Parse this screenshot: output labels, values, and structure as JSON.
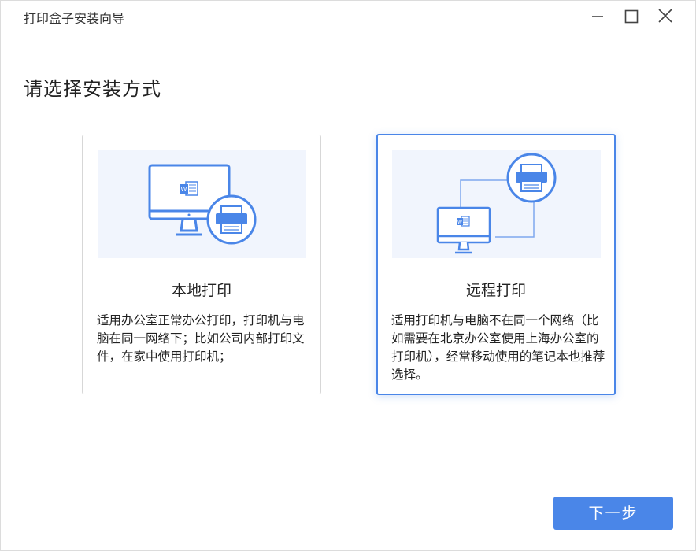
{
  "window": {
    "title": "打印盒子安装向导"
  },
  "heading": "请选择安装方式",
  "options": [
    {
      "title": "本地打印",
      "description": "适用办公室正常办公打印，打印机与电脑在同一网络下；比如公司内部打印文件，在家中使用打印机；",
      "selected": false
    },
    {
      "title": "远程打印",
      "description": "适用打印机与电脑不在同一个网络（比如需要在北京办公室使用上海办公室的打印机），经常移动使用的笔记本也推荐选择。",
      "selected": true
    }
  ],
  "next_button": "下一步",
  "colors": {
    "accent": "#4a86e8",
    "illustration_bg": "#f1f5fd"
  },
  "icons": [
    "minimize-icon",
    "maximize-icon",
    "close-icon",
    "computer-icon",
    "word-document-icon",
    "printer-icon"
  ]
}
